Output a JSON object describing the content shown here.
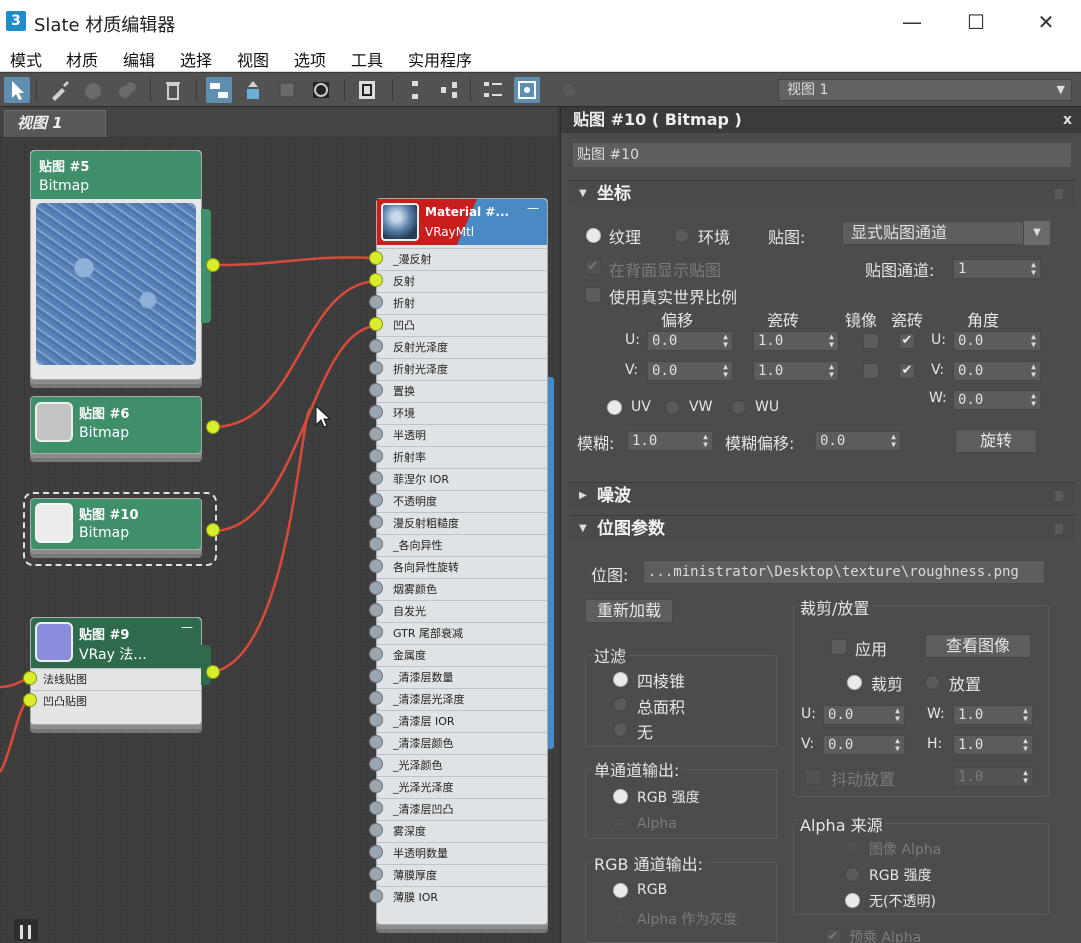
{
  "window": {
    "app_icon": "3",
    "title": "Slate 材质编辑器",
    "min": "—",
    "max": "☐",
    "close": "✕"
  },
  "menu": [
    "模式",
    "材质",
    "编辑",
    "选择",
    "视图",
    "选项",
    "工具",
    "实用程序"
  ],
  "toolbar": {
    "view_dropdown": "视图 1"
  },
  "view_tab": "视图 1",
  "nodes": {
    "map5": {
      "name": "贴图 #5",
      "type": "Bitmap"
    },
    "map6": {
      "name": "贴图 #6",
      "type": "Bitmap"
    },
    "map10": {
      "name": "贴图 #10",
      "type": "Bitmap"
    },
    "map9": {
      "name": "贴图 #9",
      "type": "VRay 法...",
      "slots": [
        "法线贴图",
        "凹凸贴图"
      ]
    },
    "material": {
      "name": "Material #...",
      "type": "VRayMtl",
      "slots": [
        "_漫反射",
        "反射",
        "折射",
        "凹凸",
        "反射光泽度",
        "折射光泽度",
        "置换",
        "环境",
        "半透明",
        "折射率",
        "菲涅尔 IOR",
        "不透明度",
        "漫反射粗糙度",
        "_各向异性",
        "各向异性旋转",
        "烟雾颜色",
        "自发光",
        "GTR 尾部衰减",
        "金属度",
        "_清漆层数量",
        "_清漆层光泽度",
        "_清漆层 IOR",
        "_清漆层颜色",
        "_光泽颜色",
        "_光泽光泽度",
        "_清漆层凹凸",
        "雾深度",
        "半透明数量",
        "薄膜厚度",
        "薄膜 IOR"
      ]
    }
  },
  "panel": {
    "header": "贴图 #10  ( Bitmap )",
    "close": "x",
    "name_field": "贴图 #10",
    "coords": {
      "title": "坐标",
      "texture": "纹理",
      "environ": "环境",
      "map_label": "贴图:",
      "map_value": "显式贴图通道",
      "show_back": "在背面显示贴图",
      "map_channel_label": "贴图通道:",
      "map_channel": "1",
      "real_world": "使用真实世界比例",
      "offset": "偏移",
      "tiling": "瓷砖",
      "mirror": "镜像",
      "tile": "瓷砖",
      "angle": "角度",
      "u": "U:",
      "v": "V:",
      "w": "W:",
      "u_offset": "0.0",
      "v_offset": "0.0",
      "u_tiling": "1.0",
      "v_tiling": "1.0",
      "u_angle": "0.0",
      "v_angle": "0.0",
      "w_angle": "0.0",
      "uv": "UV",
      "vw": "VW",
      "wu": "WU",
      "blur_label": "模糊:",
      "blur": "1.0",
      "blur_offset_label": "模糊偏移:",
      "blur_offset": "0.0",
      "rotate": "旋转"
    },
    "noise": {
      "title": "噪波"
    },
    "bitmap": {
      "title": "位图参数",
      "bitmap_label": "位图:",
      "bitmap_path": "...ministrator\\Desktop\\texture\\roughness.png",
      "reload": "重新加载",
      "filter_title": "过滤",
      "filter_pyramidal": "四棱锥",
      "filter_sat": "总面积",
      "filter_none": "无",
      "mono_title": "单通道输出:",
      "mono_rgb": "RGB 强度",
      "mono_alpha": "Alpha",
      "rgb_title": "RGB 通道输出:",
      "rgb_rgb": "RGB",
      "rgb_alpha": "Alpha 作为灰度",
      "crop_title": "裁剪/放置",
      "apply": "应用",
      "view_image": "查看图像",
      "crop": "裁剪",
      "place": "放置",
      "crop_u_label": "U:",
      "crop_u": "0.0",
      "crop_w_label": "W:",
      "crop_w": "1.0",
      "crop_v_label": "V:",
      "crop_v": "0.0",
      "crop_h_label": "H:",
      "crop_h": "1.0",
      "jitter": "抖动放置",
      "jitter_value": "1.0",
      "alpha_source_title": "Alpha 来源",
      "alpha_image": "图像 Alpha",
      "alpha_rgb": "RGB 强度",
      "alpha_none": "无(不透明)",
      "premult": "预乘 Alpha"
    }
  },
  "colors": {
    "node_green": "#3f8f6a",
    "node_dark": "#2d6b4c",
    "socket": "#d8ee2a",
    "wire": "#d94a3a",
    "material_red": "#c81e1e"
  }
}
